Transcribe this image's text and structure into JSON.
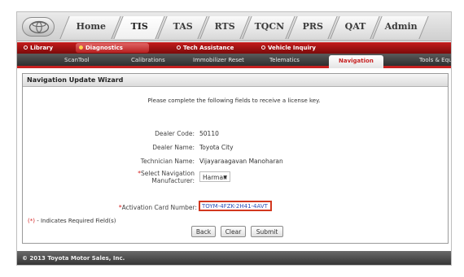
{
  "top_tabs": [
    "Home",
    "TIS",
    "TAS",
    "RTS",
    "TQCN",
    "PRS",
    "QAT",
    "Admin"
  ],
  "red_tabs": [
    "Library",
    "Diagnostics",
    "Tech Assistance",
    "Vehicle Inquiry"
  ],
  "sub_tabs": [
    "ScanTool",
    "Calibrations",
    "Immobilizer Reset",
    "Telematics",
    "Navigation",
    "Tools & Equ"
  ],
  "wizard": {
    "title": "Navigation Update Wizard",
    "intro": "Please complete the following fields to receive a license key.",
    "dealer_code_label": "Dealer Code:",
    "dealer_code_value": "50110",
    "dealer_name_label": "Dealer Name:",
    "dealer_name_value": "Toyota City",
    "technician_label": "Technician Name:",
    "technician_value": "Vijayaraagavan  Manoharan",
    "nav_manufacturer_label_1": "Select Navigation",
    "nav_manufacturer_label_2": "Manufacturer:",
    "nav_manufacturer_value": "Harman",
    "activation_label": "Activation Card Number:",
    "activation_value": "TOYM-4FZK-2H41-4AVT",
    "required_note_marker": "(*)",
    "required_note_text": " - Indicates Required Field(s)",
    "back_label": "Back",
    "clear_label": "Clear",
    "submit_label": "Submit"
  },
  "footer": {
    "copyright": "© 2013 Toyota Motor Sales, Inc."
  },
  "colors": {
    "accent_red": "#c62020",
    "required_red": "#d42020",
    "highlight_box": "#d2381f"
  }
}
